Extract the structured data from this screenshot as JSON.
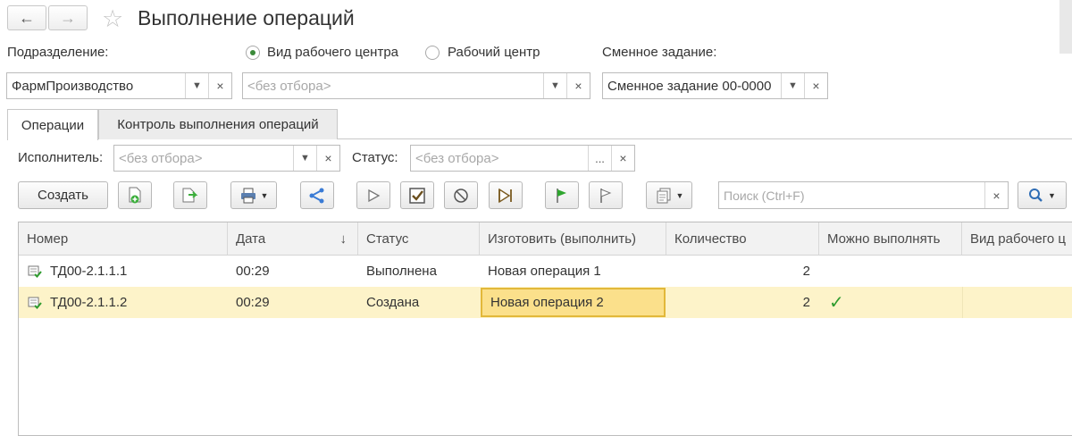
{
  "window": {
    "title": "Выполнение операций"
  },
  "filters": {
    "department_label": "Подразделение:",
    "department_value": "ФармПроизводство",
    "mode_options": [
      "Вид рабочего центра",
      "Рабочий центр"
    ],
    "mode_selected": 0,
    "workcenter_placeholder": "<без отбора>",
    "shift_task_label": "Сменное задание:",
    "shift_task_value": "Сменное задание 00-0000"
  },
  "tabs": [
    "Операции",
    "Контроль выполнения операций"
  ],
  "subfilters": {
    "executor_label": "Исполнитель:",
    "executor_placeholder": "<без отбора>",
    "status_label": "Статус:",
    "status_placeholder": "<без отбора>",
    "ellipsis": "..."
  },
  "toolbar": {
    "create_label": "Создать",
    "search_placeholder": "Поиск (Ctrl+F)"
  },
  "table": {
    "columns": [
      "Номер",
      "Дата",
      "Статус",
      "Изготовить (выполнить)",
      "Количество",
      "Можно выполнять",
      "Вид рабочего ц"
    ],
    "sort_indicator": "↓",
    "rows": [
      {
        "number": "ТД00-2.1.1.1",
        "date": "00:29",
        "status": "Выполнена",
        "operation": "Новая операция 1",
        "quantity": "2",
        "can_execute": ""
      },
      {
        "number": "ТД00-2.1.1.2",
        "date": "00:29",
        "status": "Создана",
        "operation": "Новая операция 2",
        "quantity": "2",
        "can_execute": "✓"
      }
    ]
  },
  "colors": {
    "selected_row": "#fdf3c9",
    "active_cell": "#fbe08b",
    "active_cell_border": "#e2b83a",
    "check_green": "#2e9b2e",
    "accent_green": "#3b8a3a"
  }
}
